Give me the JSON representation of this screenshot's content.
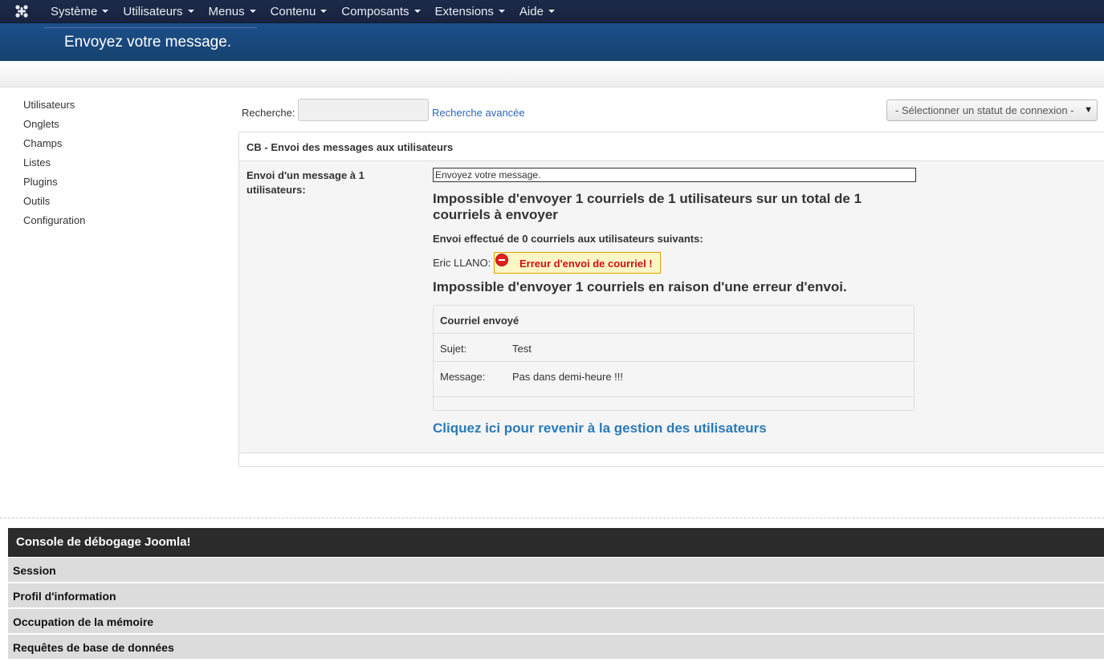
{
  "navbar": {
    "logo_icon": "joomla-logo-icon",
    "menus": [
      {
        "label": "Système"
      },
      {
        "label": "Utilisateurs"
      },
      {
        "label": "Menus"
      },
      {
        "label": "Contenu"
      },
      {
        "label": "Composants"
      },
      {
        "label": "Extensions"
      },
      {
        "label": "Aide"
      }
    ]
  },
  "header": {
    "title": "Envoyez votre message."
  },
  "sidebar": {
    "items": [
      {
        "label": "Utilisateurs"
      },
      {
        "label": "Onglets"
      },
      {
        "label": "Champs"
      },
      {
        "label": "Listes"
      },
      {
        "label": "Plugins"
      },
      {
        "label": "Outils"
      },
      {
        "label": "Configuration"
      }
    ]
  },
  "search": {
    "label": "Recherche:",
    "value": "",
    "advanced_link": "Recherche avancée",
    "status_select": "- Sélectionner un statut de connexion -"
  },
  "panel": {
    "title": "CB - Envoi des messages aux utilisateurs",
    "row_label": "Envoi d'un message à 1 utilisateurs:",
    "message_box": "Envoyez votre message.",
    "fail_heading": "Impossible d'envoyer 1 courriels de 1 utilisateurs sur un total de 1 courriels à envoyer",
    "sent_heading": "Envoi effectué de 0 courriels aux utilisateurs suivants:",
    "recipient": "Eric LLANO:",
    "error_badge": "Erreur d'envoi de courriel !",
    "fail_heading_2": "Impossible d'envoyer 1 courriels en raison d'une erreur d'envoi.",
    "mail": {
      "title": "Courriel envoyé",
      "subject_label": "Sujet:",
      "subject_value": "Test",
      "message_label": "Message:",
      "message_value": "Pas dans demi-heure !!!"
    },
    "back_link": "Cliquez ici pour revenir à la gestion des utilisateurs"
  },
  "debug": {
    "title": "Console de débogage Joomla!",
    "sections": [
      {
        "label": "Session"
      },
      {
        "label": "Profil d'information"
      },
      {
        "label": "Occupation de la mémoire"
      },
      {
        "label": "Requêtes de base de données"
      }
    ]
  },
  "colors": {
    "navbar": "#1d2a4a",
    "header": "#1c4f8a",
    "link": "#2a69b8",
    "error": "#cc1111",
    "debug_head": "#2b2b2b"
  }
}
